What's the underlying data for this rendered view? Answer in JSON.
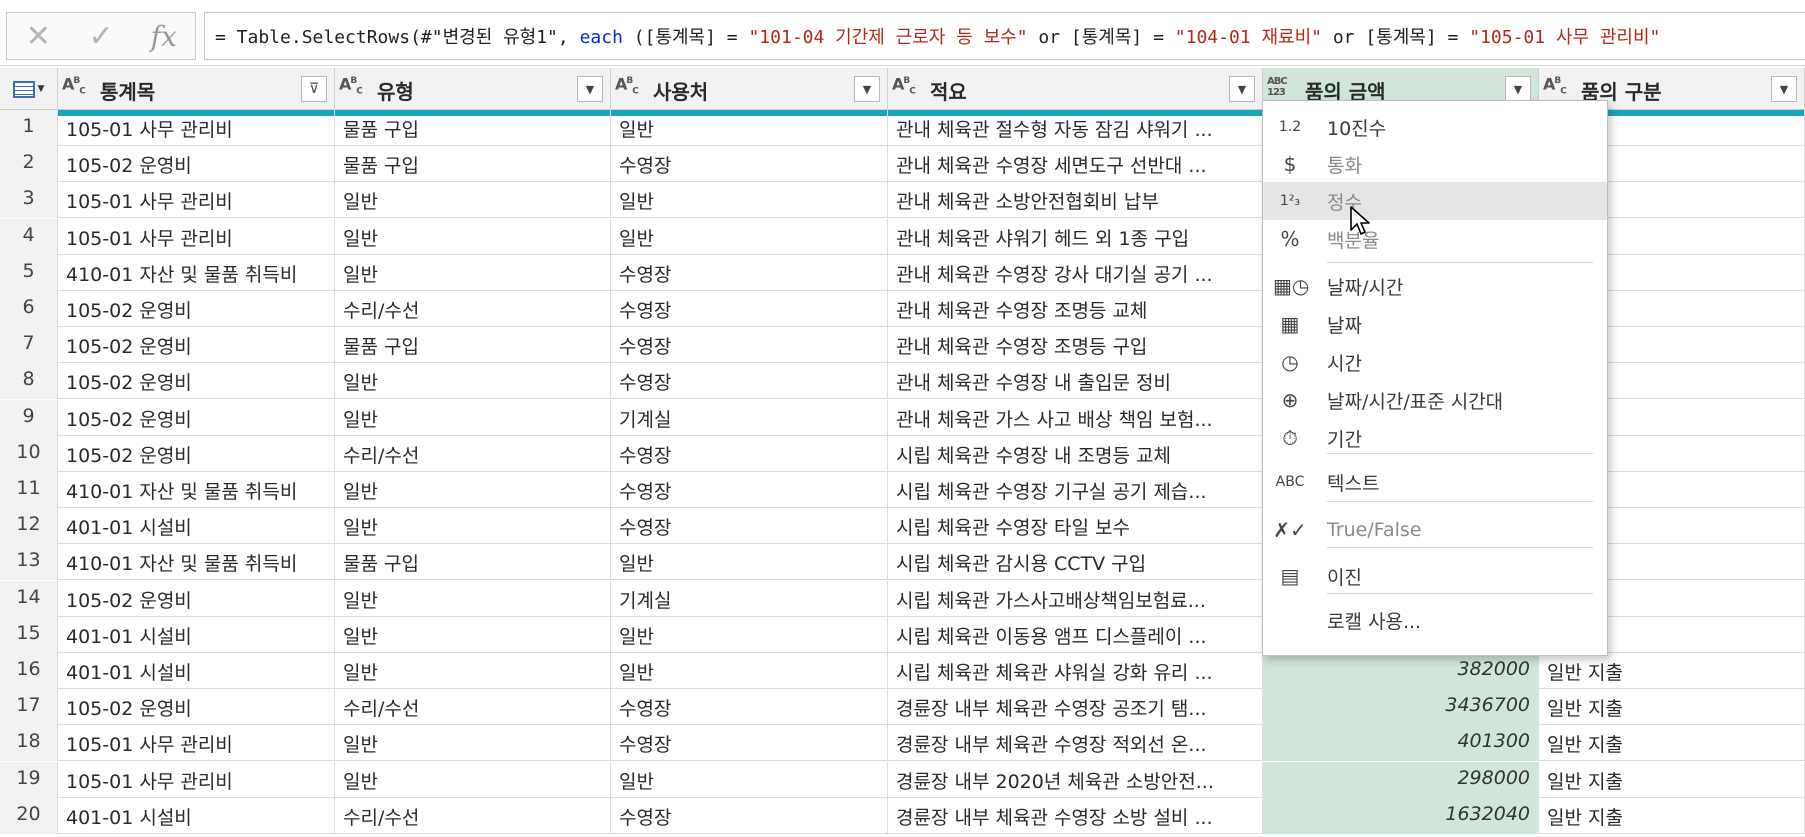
{
  "formula_bar": {
    "cancel_icon": "close-icon",
    "confirm_icon": "check-icon",
    "fx_label": "fx",
    "formula_parts": [
      {
        "t": "= Table.SelectRows(#\"변경된 유형1\", ",
        "k": "plain"
      },
      {
        "t": "each",
        "k": "kw"
      },
      {
        "t": " ([통계목] = ",
        "k": "plain"
      },
      {
        "t": "\"101-04 기간제 근로자 등 보수\"",
        "k": "str"
      },
      {
        "t": " or [통계목] = ",
        "k": "plain"
      },
      {
        "t": "\"104-01 재료비\"",
        "k": "str"
      },
      {
        "t": " or [통계목] = ",
        "k": "plain"
      },
      {
        "t": "\"105-01 사무 관리비\"",
        "k": "str"
      }
    ]
  },
  "columns": [
    {
      "name": "통계목",
      "type_icon": "ABC",
      "filtered": true
    },
    {
      "name": "유형",
      "type_icon": "ABC",
      "filtered": false
    },
    {
      "name": "사용처",
      "type_icon": "ABC",
      "filtered": false
    },
    {
      "name": "적요",
      "type_icon": "ABC",
      "filtered": false
    },
    {
      "name": "품의 금액",
      "type_icon": "ABC123",
      "filtered": false,
      "active": true
    },
    {
      "name": "품의 구분",
      "type_icon": "ABC",
      "filtered": false
    }
  ],
  "rows": [
    [
      "1",
      "105-01 사무 관리비",
      "물품 구입",
      "일반",
      "관내 체육관 절수형 자동 잠김 샤워기 ...",
      "",
      "출"
    ],
    [
      "2",
      "105-02 운영비",
      "물품 구입",
      "수영장",
      "관내 체육관 수영장 세면도구 선반대 ...",
      "",
      "출"
    ],
    [
      "3",
      "105-01 사무 관리비",
      "일반",
      "일반",
      "관내 체육관 소방안전협회비 납부",
      "",
      "출"
    ],
    [
      "4",
      "105-01 사무 관리비",
      "일반",
      "일반",
      "관내 체육관 샤워기 헤드 외 1종 구입",
      "",
      "출"
    ],
    [
      "5",
      "410-01 자산 및 물품 취득비",
      "일반",
      "수영장",
      "관내 체육관 수영장 강사 대기실 공기 ...",
      "",
      "출"
    ],
    [
      "6",
      "105-02 운영비",
      "수리/수선",
      "수영장",
      "관내 체육관 수영장 조명등 교체",
      "",
      "출"
    ],
    [
      "7",
      "105-02 운영비",
      "물품 구입",
      "수영장",
      "관내 체육관 수영장 조명등 구입",
      "",
      "출"
    ],
    [
      "8",
      "105-02 운영비",
      "일반",
      "수영장",
      "관내 체육관 수영장 내 출입문 정비",
      "",
      "출"
    ],
    [
      "9",
      "105-02 운영비",
      "일반",
      "기계실",
      "관내 체육관 가스 사고 배상 책임 보험...",
      "",
      "출"
    ],
    [
      "10",
      "105-02 운영비",
      "수리/수선",
      "수영장",
      "시립 체육관 수영장 내 조명등 교체",
      "",
      "출"
    ],
    [
      "11",
      "410-01 자산 및 물품 취득비",
      "일반",
      "수영장",
      "시립 체육관 수영장 기구실 공기 제습...",
      "",
      "출"
    ],
    [
      "12",
      "401-01 시설비",
      "일반",
      "수영장",
      "시립 체육관 수영장 타일 보수",
      "",
      "출"
    ],
    [
      "13",
      "410-01 자산 및 물품 취득비",
      "물품 구입",
      "일반",
      "시립 체육관 감시용 CCTV 구입",
      "",
      "출"
    ],
    [
      "14",
      "105-02 운영비",
      "일반",
      "기계실",
      "시립 체육관 가스사고배상책임보험료...",
      "",
      "출"
    ],
    [
      "15",
      "401-01 시설비",
      "일반",
      "일반",
      "시립 체육관 이동용 앰프 디스플레이 ...",
      "",
      "출"
    ],
    [
      "16",
      "401-01 시설비",
      "일반",
      "일반",
      "시립 체육관 체육관 샤워실 강화 유리 ...",
      "382000",
      "일반 지출"
    ],
    [
      "17",
      "105-02 운영비",
      "수리/수선",
      "수영장",
      "경륜장 내부 체육관 수영장 공조기 탬...",
      "3436700",
      "일반 지출"
    ],
    [
      "18",
      "105-01 사무 관리비",
      "일반",
      "수영장",
      "경륜장 내부 체육관 수영장 적외선 온...",
      "401300",
      "일반 지출"
    ],
    [
      "19",
      "105-01 사무 관리비",
      "일반",
      "일반",
      "경륜장 내부 2020년 체육관 소방안전...",
      "298000",
      "일반 지출"
    ],
    [
      "20",
      "401-01 시설비",
      "수리/수선",
      "수영장",
      "경륜장 내부 체육관 수영장 소방 설비 ...",
      "1632040",
      "일반 지출"
    ]
  ],
  "type_menu": {
    "items": [
      {
        "icon": "1.2",
        "icon_name": "decimal-icon",
        "label": "10진수",
        "dim": false
      },
      {
        "icon": "$",
        "icon_name": "currency-icon",
        "label": "통화",
        "dim": true
      },
      {
        "icon": "1²₃",
        "icon_name": "whole-number-icon",
        "label": "정수",
        "dim": true,
        "hover": true
      },
      {
        "icon": "%",
        "icon_name": "percent-icon",
        "label": "백분율",
        "dim": true
      },
      {
        "icon": "▦◷",
        "icon_name": "datetime-icon",
        "label": "날짜/시간",
        "dim": false
      },
      {
        "icon": "▦",
        "icon_name": "date-icon",
        "label": "날짜",
        "dim": false
      },
      {
        "icon": "◷",
        "icon_name": "time-icon",
        "label": "시간",
        "dim": false
      },
      {
        "icon": "⊕",
        "icon_name": "datetimezone-icon",
        "label": "날짜/시간/표준 시간대",
        "dim": false
      },
      {
        "icon": "⏱",
        "icon_name": "duration-icon",
        "label": "기간",
        "dim": false
      },
      {
        "icon": "ABC",
        "icon_name": "text-type-icon",
        "label": "텍스트",
        "dim": false
      },
      {
        "icon": "✗✓",
        "icon_name": "true-false-icon",
        "label": "True/False",
        "dim": true
      },
      {
        "icon": "▤",
        "icon_name": "binary-icon",
        "label": "이진",
        "dim": false
      },
      {
        "icon": "",
        "icon_name": "",
        "label": "로캘 사용...",
        "dim": false
      }
    ]
  },
  "colors": {
    "accent": "#1aa6b7",
    "active_column": "#cfe6d8",
    "highlight": "#f5e828"
  }
}
